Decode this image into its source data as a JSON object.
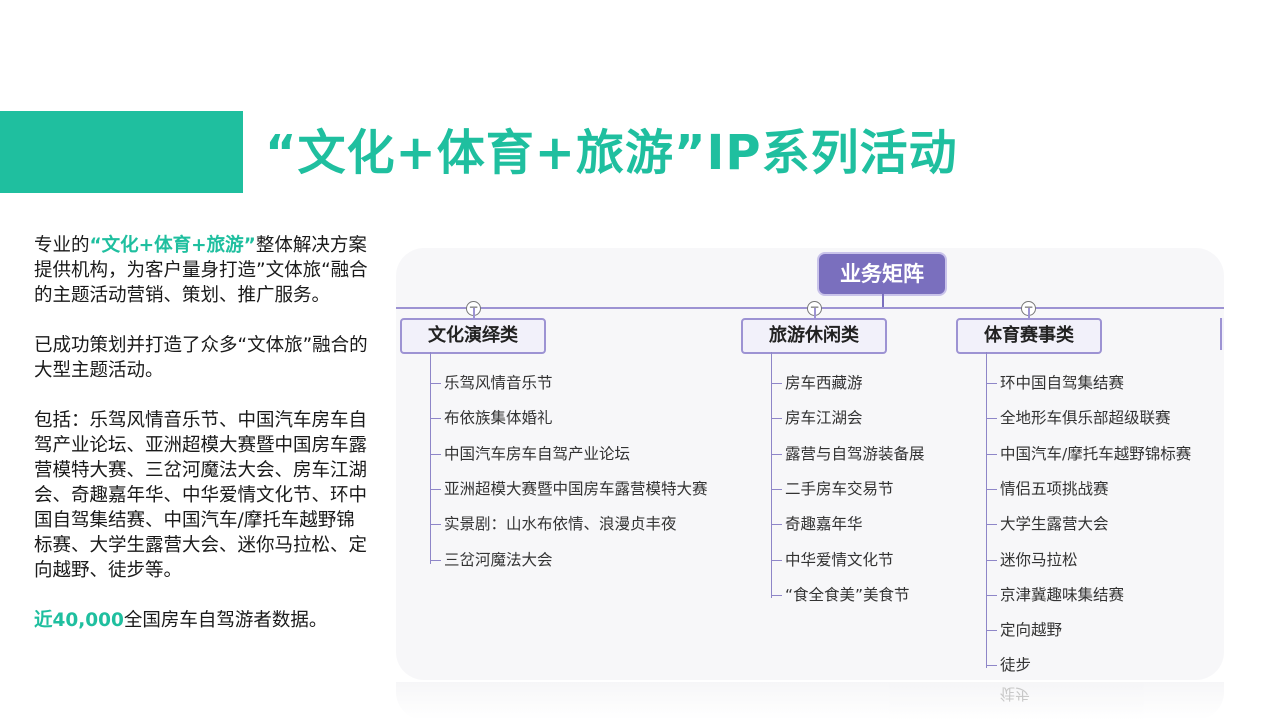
{
  "title": "“文化+体育+旅游”IP系列活动",
  "intro": {
    "p1_pre": "专业的",
    "p1_hl": "“文化+体育+旅游”",
    "p1_post": "整体解决方案提供机构，为客户量身打造”文体旅“融合的主题活动营销、策划、推广服务。",
    "p2": "已成功策划并打造了众多“文体旅”融合的大型主题活动。",
    "p3": "包括：乐驾风情音乐节、中国汽车房车自驾产业论坛、亚洲超模大赛暨中国房车露营模特大赛、三岔河魔法大会、房车江湖会、奇趣嘉年华、中华爱情文化节、环中国自驾集结赛、中国汽车/摩托车越野锦标赛、大学生露营大会、迷你马拉松、定向越野、徒步等。",
    "p4_hl": "近40,000",
    "p4_post": "全国房车自驾游者数据。"
  },
  "mindmap": {
    "root": "业务矩阵",
    "reflection_text": "徒步",
    "categories": [
      {
        "label": "文化演绎类",
        "items": [
          "乐驾风情音乐节",
          "布依族集体婚礼",
          "中国汽车房车自驾产业论坛",
          "亚洲超模大赛暨中国房车露营模特大赛",
          "实景剧：山水布依情、浪漫贞丰夜",
          "三岔河魔法大会"
        ]
      },
      {
        "label": "旅游休闲类",
        "items": [
          "房车西藏游",
          "房车江湖会",
          "露营与自驾游装备展",
          "二手房车交易节",
          "奇趣嘉年华",
          "中华爱情文化节",
          "“食全食美”美食节"
        ]
      },
      {
        "label": "体育赛事类",
        "items": [
          "环中国自驾集结赛",
          "全地形车俱乐部超级联赛",
          "中国汽车/摩托车越野锦标赛",
          "情侣五项挑战赛",
          "大学生露营大会",
          "迷你马拉松",
          "京津冀趣味集结赛",
          "定向越野",
          "徒步"
        ]
      }
    ]
  }
}
